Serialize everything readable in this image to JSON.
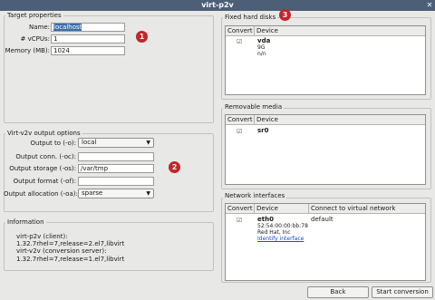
{
  "window": {
    "title": "virt-p2v",
    "close_glyph": "✕"
  },
  "target": {
    "legend": "Target properties",
    "name_label": "Name:",
    "name_value": "localhost",
    "vcpus_label": "# vCPUs:",
    "vcpus_value": "1",
    "memory_label": "Memory (MB):",
    "memory_value": "1024"
  },
  "output": {
    "legend": "Virt-v2v output options",
    "to_label": "Output to (-o):",
    "to_value": "local",
    "conn_label": "Output conn. (-oc):",
    "conn_value": "",
    "storage_label": "Output storage (-os):",
    "storage_value": "/var/tmp",
    "format_label": "Output format (-of):",
    "format_value": "",
    "alloc_label": "Output allocation (-oa):",
    "alloc_value": "sparse"
  },
  "information": {
    "legend": "Information",
    "lines": [
      "virt-p2v (client):",
      "1.32.7rhel=7,release=2.el7,libvirt",
      "virt-v2v (conversion server):",
      "1.32.7rhel=7,release=1.el7,libvirt"
    ]
  },
  "disks": {
    "legend": "Fixed hard disks",
    "col_convert": "Convert",
    "col_device": "Device",
    "rows": [
      {
        "checked": "☑",
        "name": "vda",
        "size": "9G",
        "extra": "n/n"
      }
    ]
  },
  "removable": {
    "legend": "Removable media",
    "col_convert": "Convert",
    "col_device": "Device",
    "rows": [
      {
        "checked": "☑",
        "name": "sr0"
      }
    ]
  },
  "network": {
    "legend": "Network interfaces",
    "col_convert": "Convert",
    "col_device": "Device",
    "col_connect": "Connect to virtual network",
    "rows": [
      {
        "checked": "☑",
        "name": "eth0",
        "mac": "52:54:00:00:bb:78",
        "vendor": "Red Hat, Inc",
        "link": "Identify interface",
        "network": "default"
      }
    ]
  },
  "badges": [
    "1",
    "2",
    "3"
  ],
  "buttons": {
    "back": "Back",
    "start": "Start conversion"
  },
  "colors": {
    "titlebar": "#4d5f76",
    "badge": "#c2252a",
    "selection": "#3d6ea8",
    "link": "#1a4bd0"
  }
}
